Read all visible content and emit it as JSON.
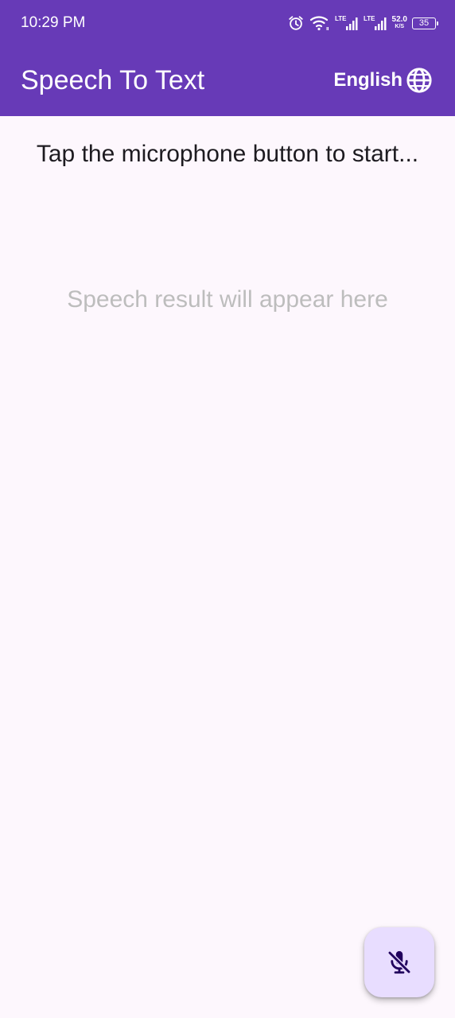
{
  "status_bar": {
    "time": "10:29 PM",
    "icons": [
      "alarm-icon",
      "wifi-icon",
      "lte-signal-icon",
      "lte-signal-icon"
    ],
    "network_speed": "52.0",
    "network_speed_unit": "K/S",
    "battery": "35"
  },
  "app_bar": {
    "title": "Speech To Text",
    "language_label": "English",
    "language_icon": "globe-icon"
  },
  "content": {
    "instruction": "Tap the microphone button to start...",
    "result_placeholder": "Speech result will appear here"
  },
  "fab": {
    "icon": "mic-off-icon"
  },
  "colors": {
    "primary": "#673ab7",
    "background": "#fdf7fd",
    "fab_background": "#e8ddff",
    "fab_icon": "#21005d",
    "placeholder": "#bdbdbd"
  }
}
